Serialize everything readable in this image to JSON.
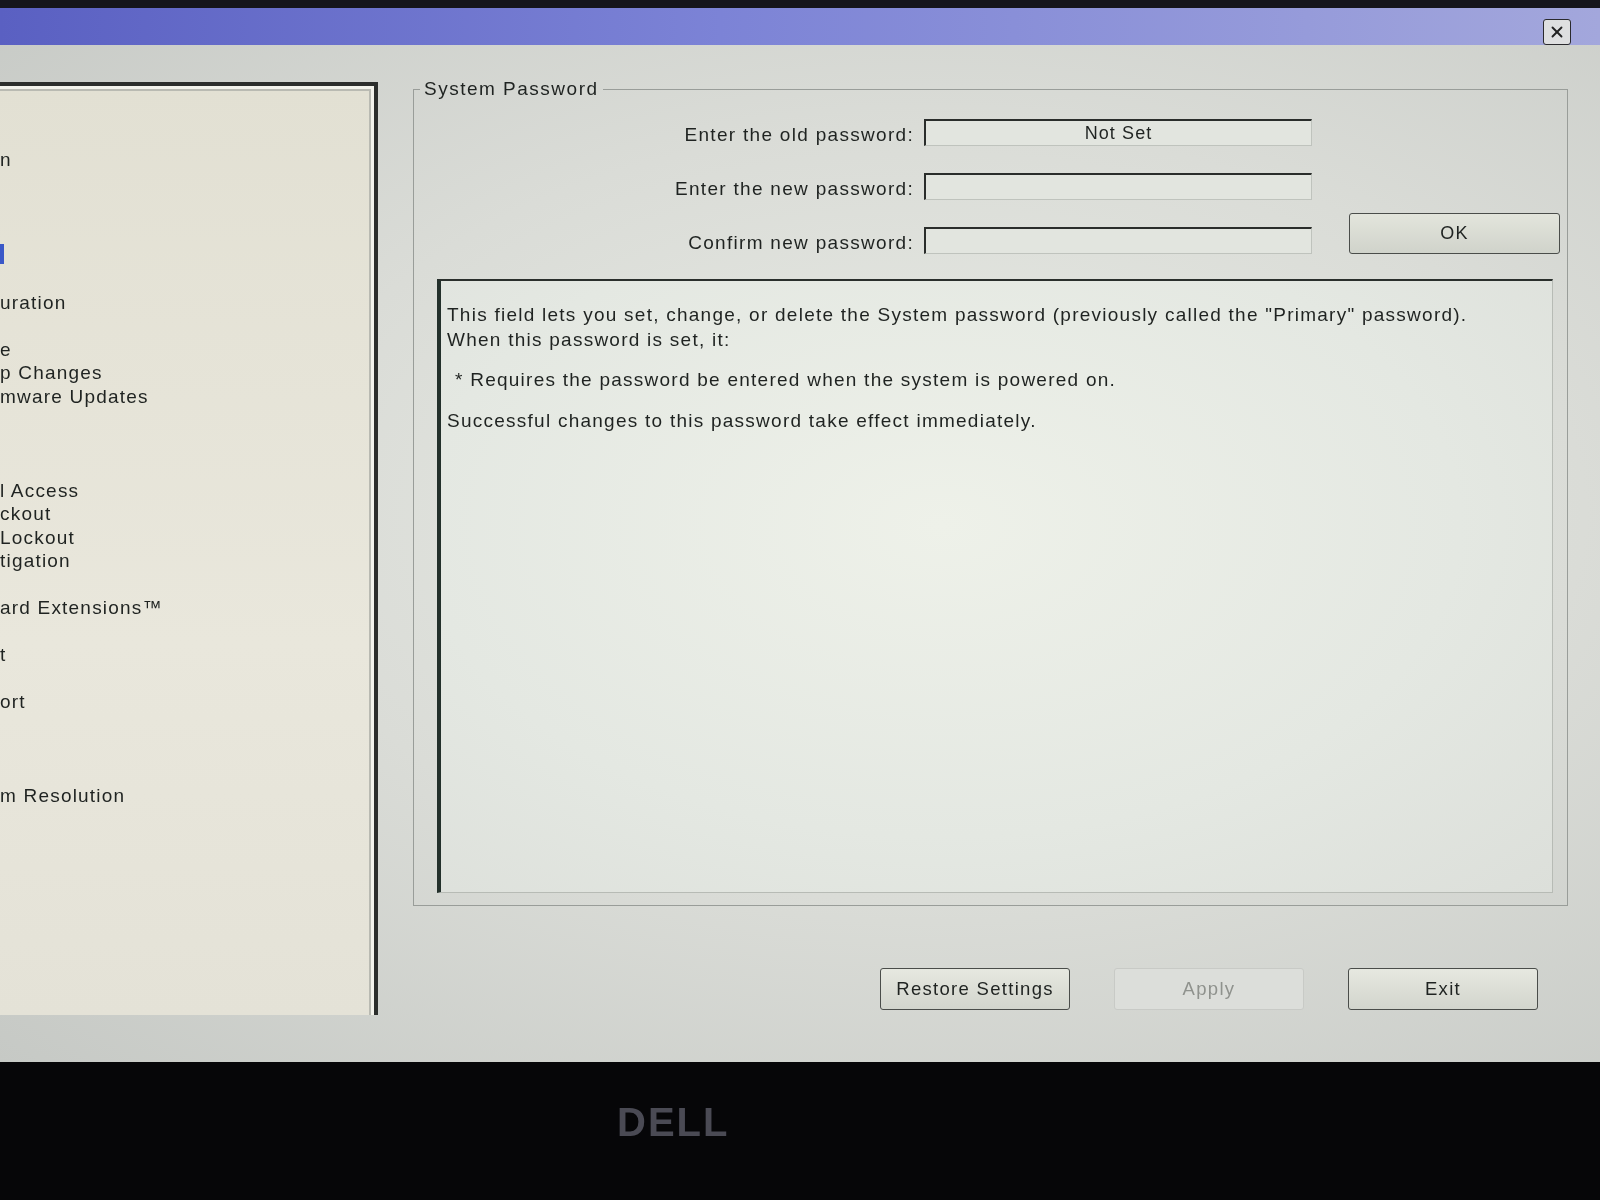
{
  "sidebar": {
    "items": [
      {
        "label": "n",
        "selected": false
      },
      {
        "selected": true
      },
      {
        "label": "uration",
        "selected": false
      },
      {
        "label": "e",
        "selected": false
      },
      {
        "label": "p Changes",
        "selected": false
      },
      {
        "label": "mware Updates",
        "selected": false
      },
      {
        "label": "l Access",
        "selected": false
      },
      {
        "label": "ckout",
        "selected": false
      },
      {
        "label": "Lockout",
        "selected": false
      },
      {
        "label": "tigation",
        "selected": false
      },
      {
        "label": "ard Extensions™",
        "selected": false
      },
      {
        "label": "t",
        "selected": false
      },
      {
        "label": "ort",
        "selected": false
      },
      {
        "label": "m Resolution",
        "selected": false
      }
    ]
  },
  "group": {
    "title": "System Password",
    "fields": [
      {
        "label": "Enter the old password:",
        "value": "Not Set"
      },
      {
        "label": "Enter the new password:"
      },
      {
        "label": "Confirm new password:"
      }
    ],
    "ok_button": "OK",
    "description": [
      {
        "kind": "paragraph",
        "lines": [
          "This field lets you set, change, or delete the System password (previously called the \"Primary\" password).",
          "When this password is set, it:"
        ]
      },
      {
        "kind": "bullet",
        "lines": [
          "* Requires the password be entered when the system is powered on."
        ]
      },
      {
        "kind": "paragraph",
        "lines": [
          "Successful changes to this password take effect immediately."
        ]
      }
    ]
  },
  "buttons": [
    {
      "label": "Restore Settings",
      "disabled": false
    },
    {
      "label": "Apply",
      "disabled": true
    },
    {
      "label": "Exit",
      "disabled": false
    }
  ],
  "monitor_logo": "DELL"
}
